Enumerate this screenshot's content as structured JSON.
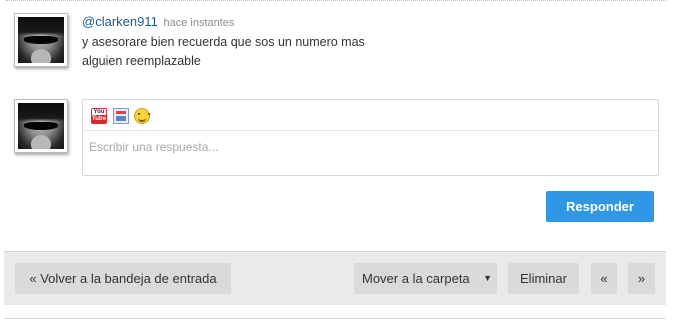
{
  "comment": {
    "username": "@clarken911",
    "timestamp": "hace instantes",
    "text_line1": "y asesorare bien recuerda que sos un numero mas",
    "text_line2": "alguien reemplazable"
  },
  "reply": {
    "toolbar_icons": [
      "youtube-icon",
      "image-icon",
      "smiley-icon"
    ],
    "youtube_icon_text_top": "You",
    "youtube_icon_text_bottom": "Tube",
    "placeholder": "Escribir una respuesta...",
    "value": "",
    "submit_label": "Responder",
    "submit_color": "#2f97e3"
  },
  "footer": {
    "back_label": "« Volver a la bandeja de entrada",
    "move_label": "Mover a la carpeta",
    "move_caret": "▼",
    "delete_label": "Eliminar",
    "prev_label": "«",
    "next_label": "»"
  }
}
